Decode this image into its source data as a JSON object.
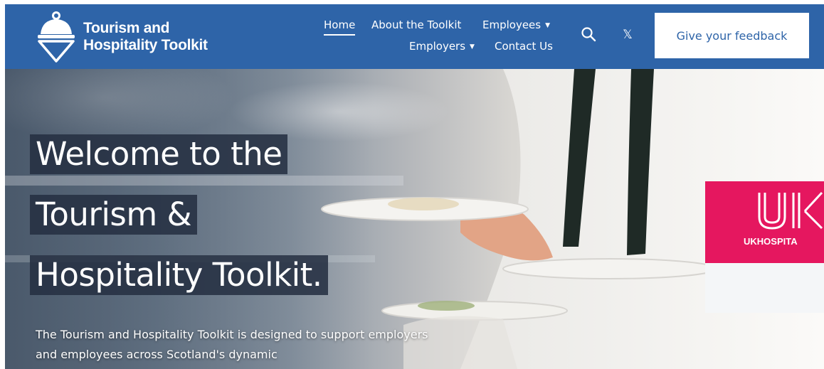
{
  "header": {
    "logo": {
      "line1": "Tourism and",
      "line2": "Hospitality Toolkit"
    },
    "nav": {
      "home": "Home",
      "about": "About the Toolkit",
      "employees": "Employees",
      "employers": "Employers",
      "contact": "Contact Us",
      "dropdown_caret": "▼"
    },
    "search_icon": "search-icon",
    "social_icon": "x-twitter-icon",
    "x_glyph": "𝕏",
    "feedback_button": "Give your feedback"
  },
  "hero": {
    "headline": [
      "Welcome to the",
      "Tourism &",
      "Hospitality Toolkit."
    ],
    "intro": "The Tourism and Hospitality Toolkit is designed to support employers and employees across Scotland's dynamic"
  },
  "partner": {
    "name": "UKHOSPITA"
  },
  "colors": {
    "header_bg": "#2e64a8",
    "headline_bg": "#263042",
    "partner_pink": "#e5175f"
  }
}
